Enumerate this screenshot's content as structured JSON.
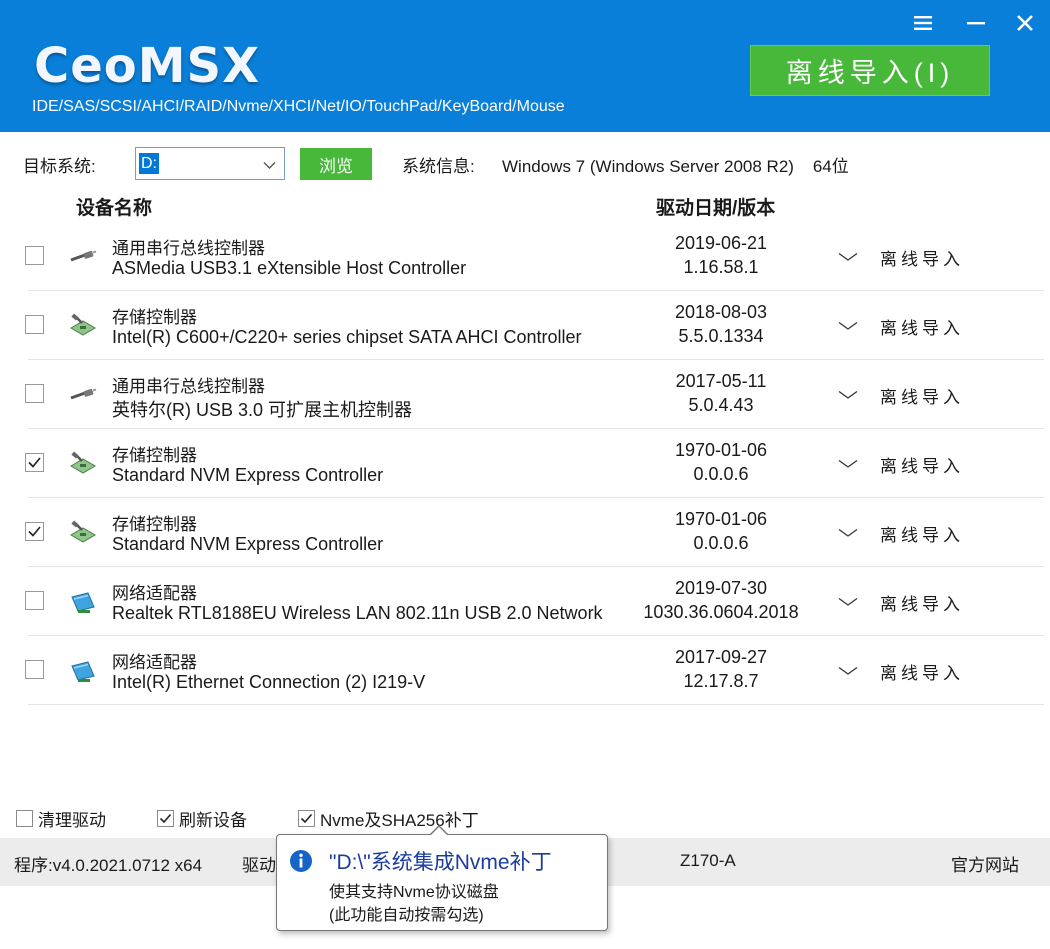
{
  "header": {
    "logo": "CeoMSX",
    "subtitle": "IDE/SAS/SCSI/AHCI/RAID/Nvme/XHCI/Net/IO/TouchPad/KeyBoard/Mouse",
    "import_button": "离线导入(I)",
    "window_controls": [
      "menu-icon",
      "minimize-icon",
      "close-icon"
    ]
  },
  "toolbar": {
    "target_label": "目标系统:",
    "target_drive": "D:",
    "browse_label": "浏览",
    "sysinfo_label": "系统信息:",
    "sysinfo_value": "Windows 7 (Windows Server 2008 R2)    64位"
  },
  "columns": {
    "device": "设备名称",
    "date_version": "驱动日期/版本"
  },
  "devices": [
    {
      "checked": false,
      "icon": "usb-icon",
      "category": "通用串行总线控制器",
      "name": "ASMedia USB3.1 eXtensible Host Controller",
      "date": "2019-06-21",
      "version": "1.16.58.1",
      "action": "离线导入"
    },
    {
      "checked": false,
      "icon": "storage-icon",
      "category": "存储控制器",
      "name": "Intel(R) C600+/C220+ series chipset SATA AHCI Controller",
      "date": "2018-08-03",
      "version": "5.5.0.1334",
      "action": "离线导入"
    },
    {
      "checked": false,
      "icon": "usb-icon",
      "category": "通用串行总线控制器",
      "name": "英特尔(R) USB 3.0 可扩展主机控制器",
      "date": "2017-05-11",
      "version": "5.0.4.43",
      "action": "离线导入"
    },
    {
      "checked": true,
      "icon": "storage-icon",
      "category": "存储控制器",
      "name": "Standard NVM Express Controller",
      "date": "1970-01-06",
      "version": "0.0.0.6",
      "action": "离线导入"
    },
    {
      "checked": true,
      "icon": "storage-icon",
      "category": "存储控制器",
      "name": "Standard NVM Express Controller",
      "date": "1970-01-06",
      "version": "0.0.0.6",
      "action": "离线导入"
    },
    {
      "checked": false,
      "icon": "network-icon",
      "category": "网络适配器",
      "name": "Realtek RTL8188EU Wireless LAN 802.11n USB 2.0 Network",
      "date": "2019-07-30",
      "version": "1030.36.0604.2018",
      "action": "离线导入"
    },
    {
      "checked": false,
      "icon": "network-icon",
      "category": "网络适配器",
      "name": "Intel(R) Ethernet Connection (2) I219-V",
      "date": "2017-09-27",
      "version": "12.17.8.7",
      "action": "离线导入"
    }
  ],
  "options": [
    {
      "label": "清理驱动",
      "checked": false
    },
    {
      "label": "刷新设备",
      "checked": true
    },
    {
      "label": "Nvme及SHA256补丁",
      "checked": true
    }
  ],
  "status": {
    "program": "程序:v4.0.2021.0712 x64",
    "driver_prefix": "驱动",
    "board": "Z170-A",
    "website": "官方网站"
  },
  "tooltip": {
    "title": "\"D:\\\"系统集成Nvme补丁",
    "line1": "使其支持Nvme协议磁盘",
    "line2": "(此功能自动按需勾选)"
  },
  "colors": {
    "header_blue": "#0a7fd9",
    "accent_green": "#47b83a",
    "selection_blue": "#0078d7",
    "tooltip_title": "#1b3c9e",
    "statusbar_gray": "#ececec"
  }
}
